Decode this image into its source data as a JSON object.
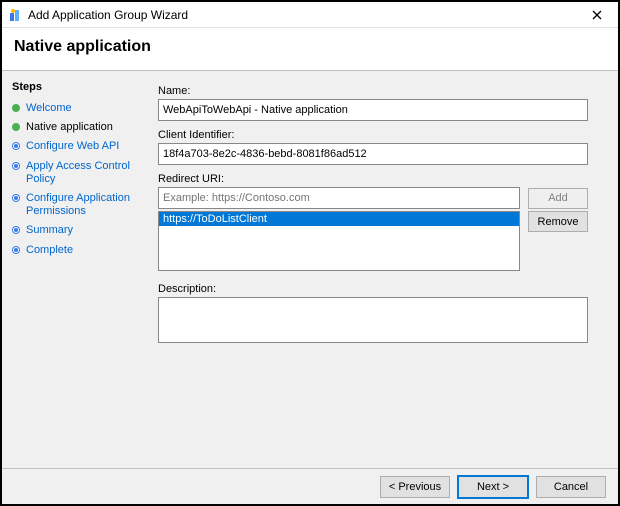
{
  "window": {
    "title": "Add Application Group Wizard",
    "heading": "Native application"
  },
  "steps": {
    "heading": "Steps",
    "items": [
      {
        "label": "Welcome",
        "state": "done",
        "link": true
      },
      {
        "label": "Native application",
        "state": "done",
        "link": false
      },
      {
        "label": "Configure Web API",
        "state": "pending",
        "link": true
      },
      {
        "label": "Apply Access Control Policy",
        "state": "pending",
        "link": true
      },
      {
        "label": "Configure Application Permissions",
        "state": "pending",
        "link": true
      },
      {
        "label": "Summary",
        "state": "pending",
        "link": true
      },
      {
        "label": "Complete",
        "state": "pending",
        "link": true
      }
    ]
  },
  "form": {
    "name_label": "Name:",
    "name_value": "WebApiToWebApi - Native application",
    "client_id_label": "Client Identifier:",
    "client_id_value": "18f4a703-8e2c-4836-bebd-8081f86ad512",
    "redirect_label": "Redirect URI:",
    "redirect_placeholder": "Example: https://Contoso.com",
    "redirect_items": [
      "https://ToDoListClient"
    ],
    "add_label": "Add",
    "remove_label": "Remove",
    "description_label": "Description:",
    "description_value": ""
  },
  "footer": {
    "previous": "< Previous",
    "next": "Next >",
    "cancel": "Cancel"
  }
}
